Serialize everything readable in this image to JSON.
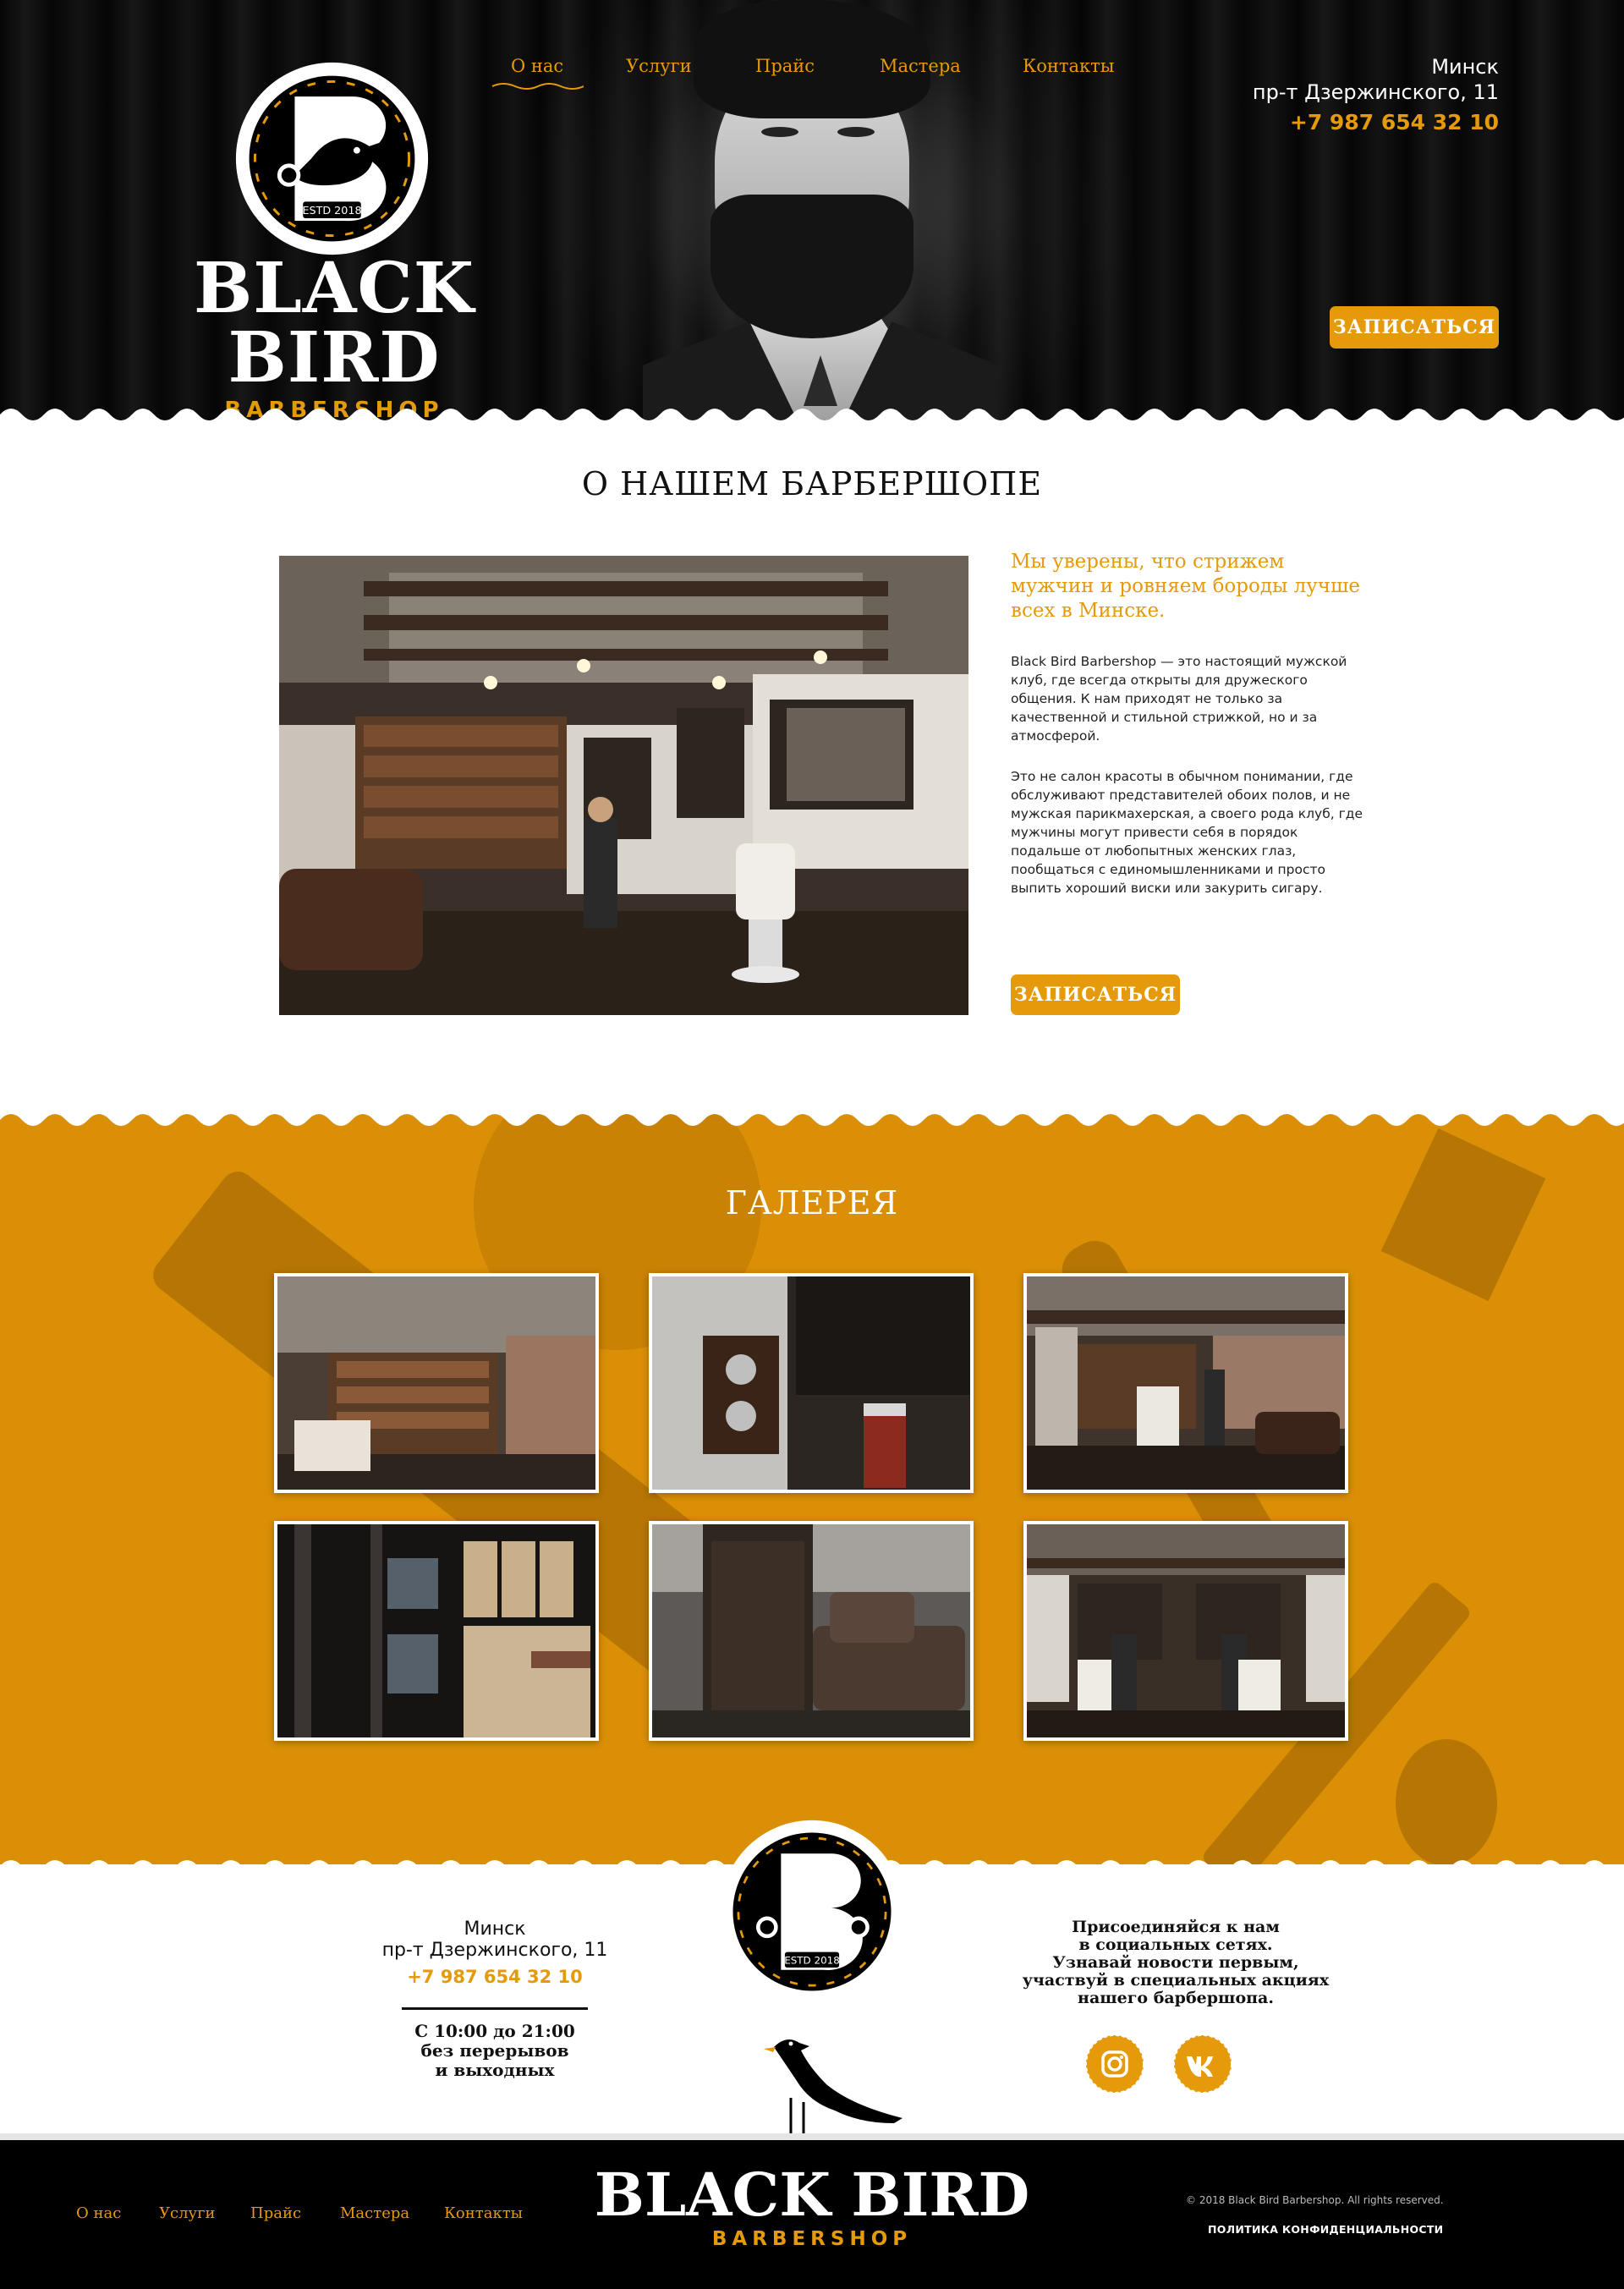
{
  "brand": {
    "name": "BLACK BIRD",
    "sub": "BARBERSHOP",
    "estd": "ESTD 2018"
  },
  "nav": {
    "items": [
      "О нас",
      "Услуги",
      "Прайс",
      "Мастера",
      "Контакты"
    ],
    "active": "О нас"
  },
  "contacts": {
    "city": "Минск",
    "street": "пр-т Дзержинского, 11",
    "phone": "+7 987 654 32 10"
  },
  "cta": {
    "label": "ЗАПИСАТЬСЯ"
  },
  "about": {
    "title": "О НАШЕМ БАРБЕРШОПЕ",
    "lead": "Мы уверены, что стрижем мужчин и ровняем бороды лучше всех в Минске.",
    "p1": "Black Bird Barbershop — это настоящий мужской клуб, где всегда открыты для дружеского общения. К нам приходят не только за качественной и стильной стрижкой, но и за атмосферой.",
    "p2": "Это не салон красоты в обычном понимании, где обслуживают представителей обоих полов, и не мужская парикмахерская, а своего рода клуб, где мужчины могут привести себя в порядок подальше от любопытных женских глаз, пообщаться с единомышленниками и просто выпить хороший виски или закурить сигару."
  },
  "gallery": {
    "title": "ГАЛЕРЕЯ",
    "photos": [
      "bookshelf-interior",
      "wall-switch-detail",
      "barber-chair-room",
      "product-shelves",
      "barber-apron",
      "barbers-at-work"
    ]
  },
  "hours": {
    "line1": "С 10:00 до 21:00",
    "line2": "без перерывов",
    "line3": "и выходных"
  },
  "social": {
    "l1": "Присоединяйся к нам",
    "l2": "в социальных сетях.",
    "l3": "Узнавай новости первым,",
    "l4": "участвуй в специальных акциях",
    "l5": "нашего барбершопа.",
    "icons": [
      "instagram-icon",
      "vk-icon"
    ]
  },
  "footer": {
    "copyright": "© 2018 Black Bird Barbershop. All rights reserved.",
    "privacy": "ПОЛИТИКА КОНФИДЕНЦИАЛЬНОСТИ"
  },
  "colors": {
    "accent": "#e59a0b",
    "dark": "#000000",
    "gallery_bg": "#db8f06"
  }
}
